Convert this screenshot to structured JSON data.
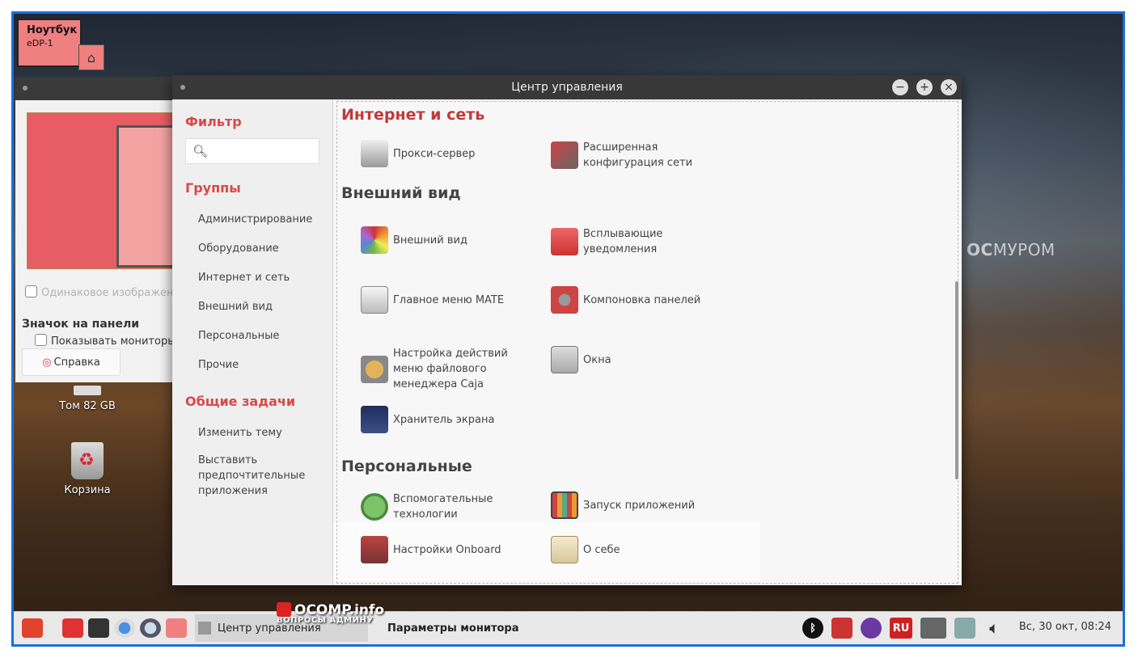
{
  "display_label": {
    "name": "Ноутбук",
    "port": "eDP-1"
  },
  "bg_window": {
    "same_image": "Одинаковое изображени",
    "panel_icon": "Значок на панели",
    "show_monitors": "Показывать мониторы",
    "help": "Справка"
  },
  "desktop": {
    "volume": "Том 82 GB",
    "trash": "Корзина",
    "city_logo_bold": "ОС",
    "city_logo": "МУРОМ"
  },
  "window": {
    "title": "Центр управления",
    "sidebar": {
      "filter_label": "Фильтр",
      "search_placeholder": "",
      "groups_label": "Группы",
      "groups": [
        "Администрирование",
        "Оборудование",
        "Интернет и сеть",
        "Внешний вид",
        "Персональные",
        "Прочие"
      ],
      "tasks_label": "Общие задачи",
      "tasks": [
        "Изменить тему",
        "Выставить предпочтительные приложения"
      ]
    },
    "sections": {
      "internet": {
        "title": "Интернет и сеть",
        "items": [
          "Прокси-сервер",
          "Расширенная конфигурация сети"
        ]
      },
      "appearance": {
        "title": "Внешний вид",
        "items": [
          "Внешний вид",
          "Всплывающие уведомления",
          "Главное меню MATE",
          "Компоновка панелей",
          "Настройка действий меню файлового менеджера Caja",
          "Окна",
          "Хранитель экрана"
        ]
      },
      "personal": {
        "title": "Персональные",
        "items": [
          "Вспомогательные технологии",
          "Запуск приложений",
          "Настройки Onboard",
          "О себе"
        ]
      }
    }
  },
  "taskbar": {
    "task1": "Центр управления",
    "task2": "Параметры монитора",
    "watermark": "OCOMP.info",
    "watermark_sub": "ВОПРОСЫ АДМИНУ",
    "lang": "RU",
    "clock": "Вс, 30 окт, 08:24"
  }
}
